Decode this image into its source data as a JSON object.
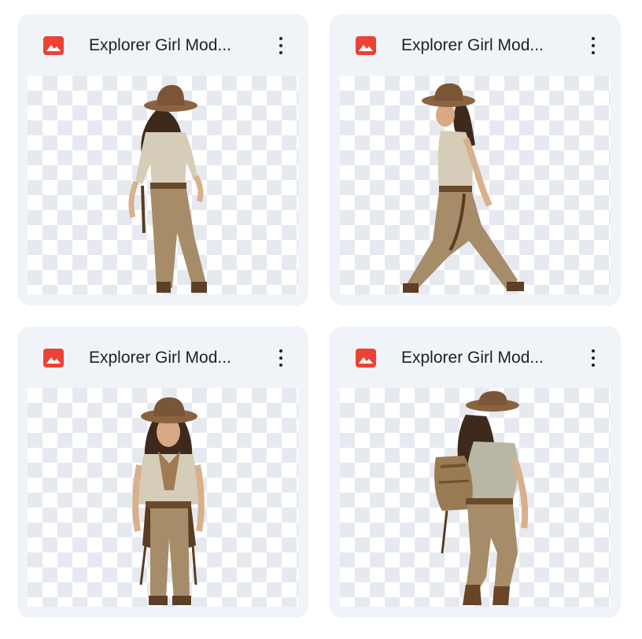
{
  "files": [
    {
      "title": "Explorer Girl Mod...",
      "icon": "image-file-icon",
      "pose": "back-walking"
    },
    {
      "title": "Explorer Girl Mod...",
      "icon": "image-file-icon",
      "pose": "side-walking"
    },
    {
      "title": "Explorer Girl Mod...",
      "icon": "image-file-icon",
      "pose": "front-standing"
    },
    {
      "title": "Explorer Girl Mod...",
      "icon": "image-file-icon",
      "pose": "back-with-backpack"
    }
  ],
  "colors": {
    "card_bg": "#f0f4f9",
    "icon_red": "#ea4335",
    "text": "#1f1f1f",
    "checker": "#e6eaf0"
  }
}
